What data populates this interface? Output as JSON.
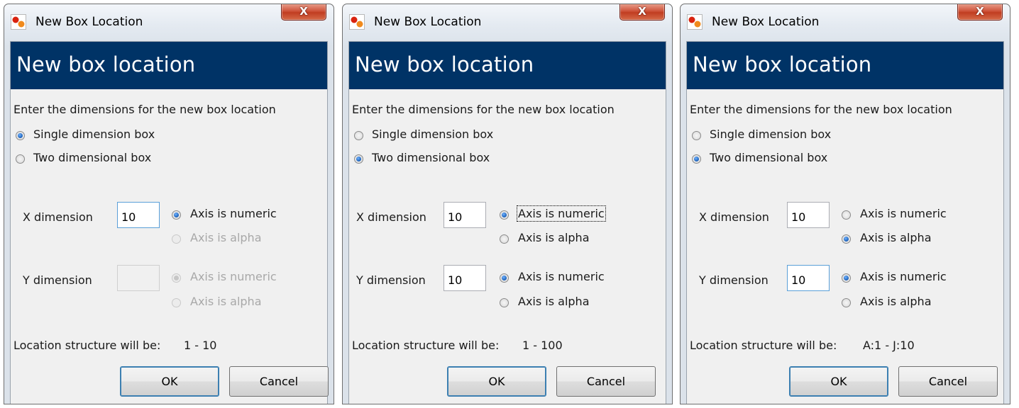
{
  "dialogs": [
    {
      "window_title": "New Box Location",
      "close_label": "X",
      "banner_title": "New box location",
      "instruction": "Enter the dimensions for the new box location",
      "box_type": {
        "single_label": "Single dimension box",
        "two_label": "Two dimensional box",
        "selected": "single"
      },
      "x_dimension": {
        "label": "X dimension",
        "value": "10",
        "numeric_label": "Axis is numeric",
        "alpha_label": "Axis is alpha",
        "selected": "numeric"
      },
      "y_dimension": {
        "label": "Y dimension",
        "value": "",
        "numeric_label": "Axis is numeric",
        "alpha_label": "Axis is alpha",
        "selected": "numeric",
        "disabled": true
      },
      "structure_label": "Location structure will be:",
      "structure_value": "1 - 10",
      "ok_label": "OK",
      "cancel_label": "Cancel"
    },
    {
      "window_title": "New Box Location",
      "close_label": "X",
      "banner_title": "New box location",
      "instruction": "Enter the dimensions for the new box location",
      "box_type": {
        "single_label": "Single dimension box",
        "two_label": "Two dimensional box",
        "selected": "two"
      },
      "x_dimension": {
        "label": "X dimension",
        "value": "10",
        "numeric_label": "Axis is numeric",
        "alpha_label": "Axis is alpha",
        "selected": "numeric"
      },
      "y_dimension": {
        "label": "Y dimension",
        "value": "10",
        "numeric_label": "Axis is numeric",
        "alpha_label": "Axis is alpha",
        "selected": "numeric",
        "disabled": false
      },
      "structure_label": "Location structure will be:",
      "structure_value": "1 - 100",
      "ok_label": "OK",
      "cancel_label": "Cancel"
    },
    {
      "window_title": "New Box Location",
      "close_label": "X",
      "banner_title": "New box location",
      "instruction": "Enter the dimensions for the new box location",
      "box_type": {
        "single_label": "Single dimension box",
        "two_label": "Two dimensional box",
        "selected": "two"
      },
      "x_dimension": {
        "label": "X dimension",
        "value": "10",
        "numeric_label": "Axis is numeric",
        "alpha_label": "Axis is alpha",
        "selected": "alpha"
      },
      "y_dimension": {
        "label": "Y dimension",
        "value": "10",
        "numeric_label": "Axis is numeric",
        "alpha_label": "Axis is alpha",
        "selected": "numeric",
        "disabled": false
      },
      "structure_label": "Location structure will be:",
      "structure_value": "A:1 - J:10",
      "ok_label": "OK",
      "cancel_label": "Cancel"
    }
  ],
  "colors": {
    "banner": "#003366",
    "client_bg": "#f0f0f0",
    "close_button": "#c94a30"
  },
  "icons": {
    "app": "app-logo-icon",
    "close": "close-icon"
  }
}
